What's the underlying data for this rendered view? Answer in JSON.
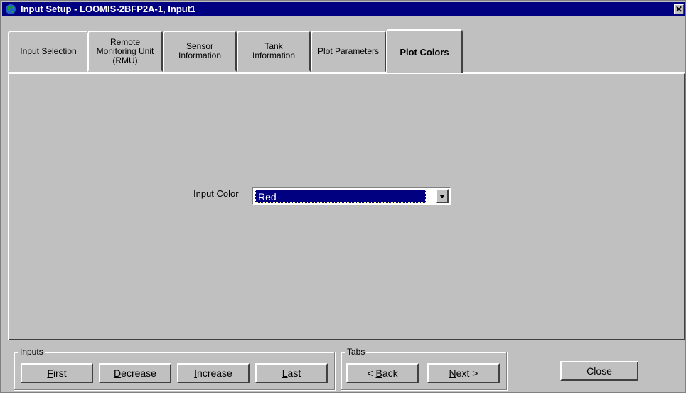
{
  "window": {
    "title": "Input Setup - LOOMIS-2BFP2A-1, Input1",
    "close_glyph": "✕",
    "icon": "globe-icon"
  },
  "tabs": [
    {
      "label": "Input Selection",
      "active": false
    },
    {
      "label": "Remote\nMonitoring Unit\n(RMU)",
      "active": false
    },
    {
      "label": "Sensor\nInformation",
      "active": false
    },
    {
      "label": "Tank\nInformation",
      "active": false
    },
    {
      "label": "Plot Parameters",
      "active": false
    },
    {
      "label": "Plot Colors",
      "active": true
    }
  ],
  "plot_colors": {
    "input_color_label": "Input Color",
    "input_color_value": "Red"
  },
  "inputs_group": {
    "title": "Inputs",
    "first": {
      "mnemonic": "F",
      "rest": "irst"
    },
    "decrease": {
      "mnemonic": "D",
      "rest": "ecrease"
    },
    "increase": {
      "mnemonic": "I",
      "rest": "ncrease"
    },
    "last": {
      "mnemonic": "L",
      "rest": "ast"
    }
  },
  "tabs_group": {
    "title": "Tabs",
    "back": {
      "prefix": "< ",
      "mnemonic": "B",
      "rest": "ack"
    },
    "next": {
      "mnemonic": "N",
      "rest": "ext",
      "suffix": " >"
    }
  },
  "close_label": "Close"
}
